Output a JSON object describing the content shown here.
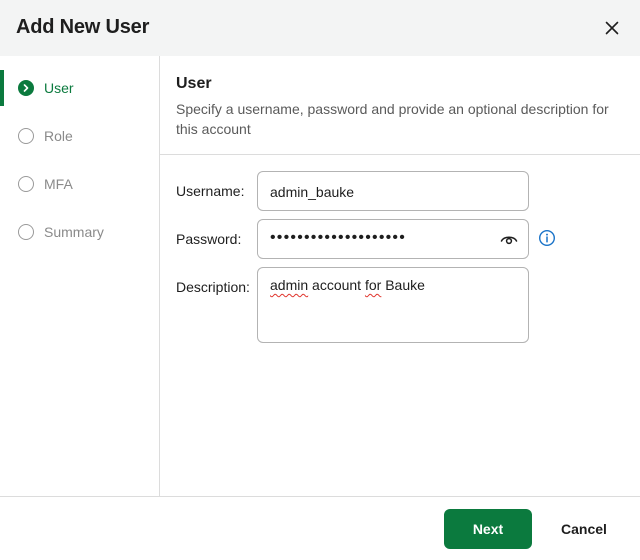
{
  "dialog": {
    "title": "Add New User",
    "close_icon": "close-icon"
  },
  "steps": [
    {
      "label": "User",
      "state": "active",
      "icon": "chevron-right-icon"
    },
    {
      "label": "Role",
      "state": "pending"
    },
    {
      "label": "MFA",
      "state": "pending"
    },
    {
      "label": "Summary",
      "state": "pending"
    }
  ],
  "section": {
    "title": "User",
    "description": "Specify a username, password and provide an optional description for this account"
  },
  "form": {
    "username": {
      "label": "Username:",
      "value": "admin_bauke"
    },
    "password": {
      "label": "Password:",
      "masked_value": "••••••••••••••••••••",
      "toggle_icon": "eye-icon",
      "info_icon": "info-icon"
    },
    "description": {
      "label": "Description:",
      "value": "admin account for Bauke",
      "parts": [
        {
          "text": "admin",
          "misspelled": true
        },
        {
          "text": " account ",
          "misspelled": false
        },
        {
          "text": "for",
          "misspelled": true
        },
        {
          "text": " Bauke",
          "misspelled": false
        }
      ]
    }
  },
  "footer": {
    "next_label": "Next",
    "cancel_label": "Cancel"
  },
  "colors": {
    "accent": "#0b7a3e",
    "info": "#1a73c8",
    "header_bg": "#f3f4f4",
    "border": "#dcdcdc",
    "spellcheck": "#e0342c"
  }
}
